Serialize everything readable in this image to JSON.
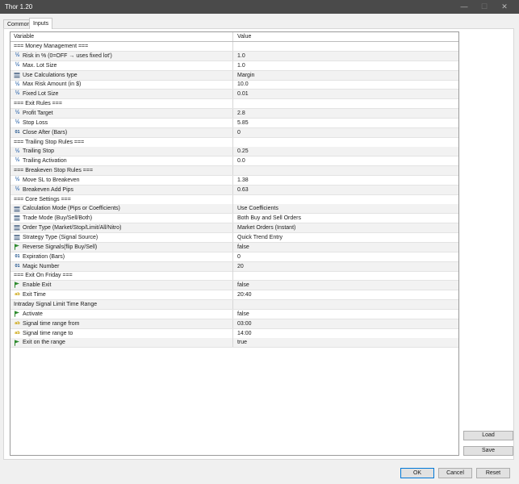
{
  "window": {
    "title": "Thor 1.20",
    "controls": [
      "—",
      "☐",
      "✕"
    ]
  },
  "tabs": [
    {
      "label": "Common"
    },
    {
      "label": "Inputs"
    }
  ],
  "grid": {
    "columns": {
      "variable": "Variable",
      "value": "Value"
    },
    "rows": [
      {
        "name": "=== Money Management ===",
        "value": "",
        "icon": "none"
      },
      {
        "name": "Risk in % (0=OFF → uses fixed lot')",
        "value": "1.0",
        "icon": "fraction-icon"
      },
      {
        "name": "Max. Lot Size",
        "value": "1.0",
        "icon": "fraction-icon"
      },
      {
        "name": "Use Calculations type",
        "value": "Margin",
        "icon": "enum-icon"
      },
      {
        "name": "Max Risk Amount (in $)",
        "value": "10.0",
        "icon": "fraction-icon"
      },
      {
        "name": "Fixed Lot Size",
        "value": "0.01",
        "icon": "fraction-icon"
      },
      {
        "name": "=== Exit Rules ===",
        "value": "",
        "icon": "none"
      },
      {
        "name": "Profit Target",
        "value": "2.8",
        "icon": "fraction-icon"
      },
      {
        "name": "Stop Loss",
        "value": "5.85",
        "icon": "fraction-icon"
      },
      {
        "name": "Close After (Bars)",
        "value": "0",
        "icon": "integer-icon"
      },
      {
        "name": "=== Trailing Stop Rules ===",
        "value": "",
        "icon": "none"
      },
      {
        "name": "Trailing Stop",
        "value": "0.25",
        "icon": "fraction-icon"
      },
      {
        "name": "Trailing Activation",
        "value": "0.0",
        "icon": "fraction-icon"
      },
      {
        "name": "=== Breakeven Stop Rules ===",
        "value": "",
        "icon": "none"
      },
      {
        "name": "Move SL to Breakeven",
        "value": "1.38",
        "icon": "fraction-icon"
      },
      {
        "name": "Breakeven Add Pips",
        "value": "0.63",
        "icon": "fraction-icon"
      },
      {
        "name": "=== Core Settings ===",
        "value": "",
        "icon": "none"
      },
      {
        "name": "Calculation Mode (Pips or Coefficients)",
        "value": "Use Coefficients",
        "icon": "enum-icon"
      },
      {
        "name": "Trade Mode (Buy/Sell/Both)",
        "value": "Both Buy and Sell Orders",
        "icon": "enum-icon"
      },
      {
        "name": "Order Type (Market/Stop/Limit/All/Nitro)",
        "value": "Market Orders (Instant)",
        "icon": "enum-icon"
      },
      {
        "name": "Strategy Type (Signal Source)",
        "value": "Quick Trend Entry",
        "icon": "enum-icon"
      },
      {
        "name": "Reverse Signals(flip Buy/Sell)",
        "value": "false",
        "icon": "flag-icon"
      },
      {
        "name": "Expiration (Bars)",
        "value": "0",
        "icon": "integer-icon"
      },
      {
        "name": "Magic Number",
        "value": "20",
        "icon": "integer-icon"
      },
      {
        "name": "=== Exit On Friday ===",
        "value": "",
        "icon": "none"
      },
      {
        "name": "Enable Exit",
        "value": "false",
        "icon": "flag-icon"
      },
      {
        "name": "Exit Time",
        "value": "20:40",
        "icon": "string-icon"
      },
      {
        "name": "Intraday Signal Limit Time Range",
        "value": "",
        "icon": "none"
      },
      {
        "name": "Activate",
        "value": "false",
        "icon": "flag-icon"
      },
      {
        "name": "Signal time range from",
        "value": "03:00",
        "icon": "string-icon"
      },
      {
        "name": "Signal time range to",
        "value": "14:00",
        "icon": "string-icon"
      },
      {
        "name": "Exit on the range",
        "value": "true",
        "icon": "flag-icon"
      }
    ]
  },
  "side_buttons": {
    "load": "Load",
    "save": "Save"
  },
  "dialog_buttons": {
    "ok": "OK",
    "cancel": "Cancel",
    "reset": "Reset"
  },
  "colors": {
    "titlebar": "#4a4a4a",
    "flag": "#2e8b2e",
    "integer": "#1a4f8a",
    "string": "#c9a000",
    "fraction": "#3a6fb0"
  }
}
